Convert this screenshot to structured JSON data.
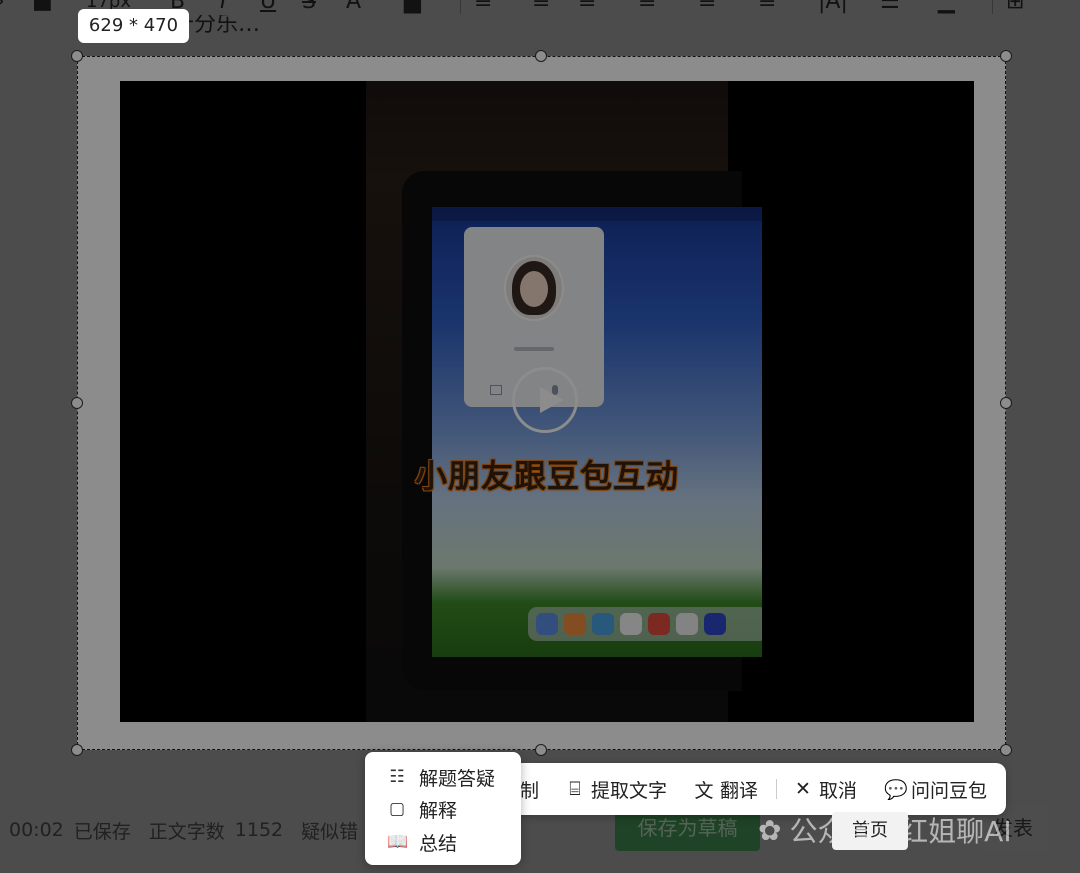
{
  "toolbar": {
    "font_size": "17px",
    "items": [
      "B",
      "I",
      "U",
      "S",
      "A"
    ]
  },
  "background_title_fragment": "…十分乐…",
  "image": {
    "size_badge": "629 * 470",
    "subtitle": "小朋友跟豆包互动"
  },
  "action_bar": {
    "copy_partial": "制",
    "extract_text": "提取文字",
    "translate": "翻译",
    "cancel": "取消",
    "ask_doubao": "问问豆包"
  },
  "menu": {
    "items": [
      {
        "label": "解题答疑",
        "icon": "question-answer-icon"
      },
      {
        "label": "解释",
        "icon": "explain-icon"
      },
      {
        "label": "总结",
        "icon": "book-icon"
      }
    ]
  },
  "status_bar": {
    "time": "00:02",
    "saved": "已保存",
    "word_count_label": "正文字数",
    "word_count": "1152",
    "suspect_partial": "疑似错"
  },
  "buttons": {
    "save_draft": "保存为草稿",
    "publish": "发表"
  },
  "tooltip": {
    "home": "首页"
  },
  "watermark": "公众号 · 红姐聊AI",
  "colors": {
    "save_draft_bg": "#3a7a45",
    "overlay": "rgba(0,0,0,0.45)",
    "subtitle_outline": "#e67a1a"
  }
}
